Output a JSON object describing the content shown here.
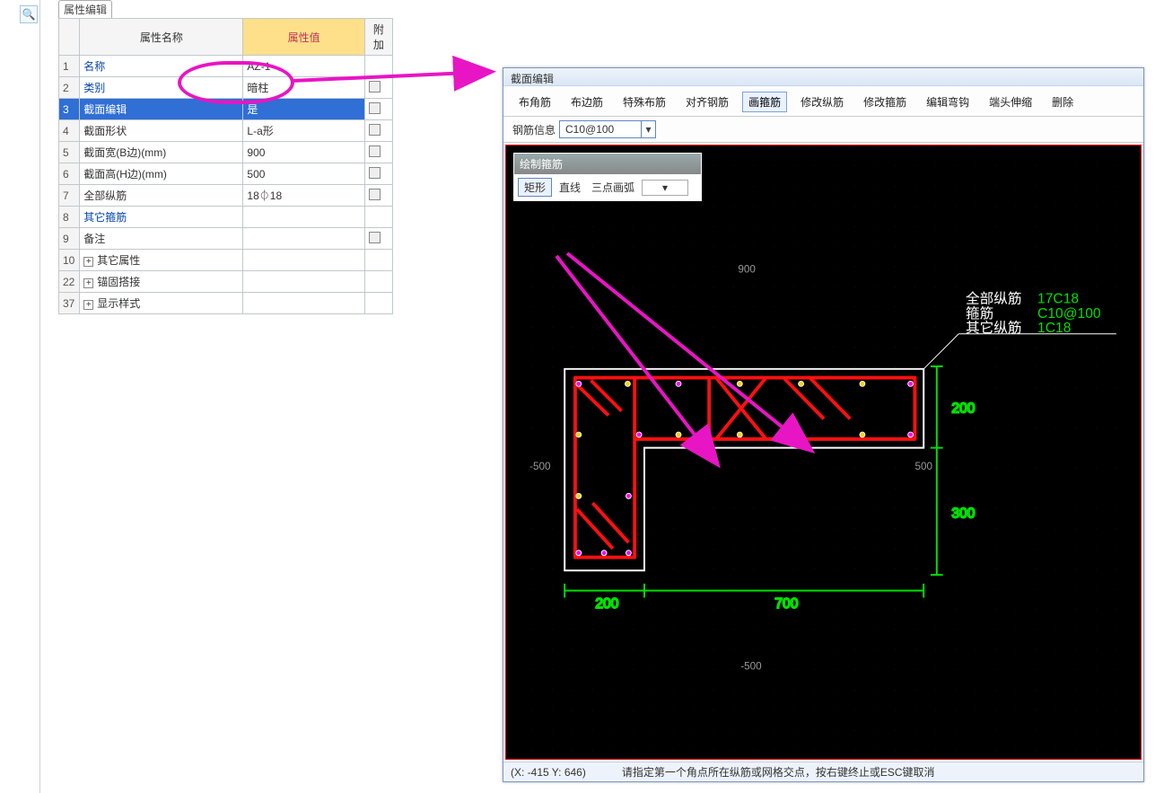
{
  "leftStrip": {
    "searchIcon": "🔍"
  },
  "propertyTab": {
    "label": "属性编辑"
  },
  "propertyGrid": {
    "headers": {
      "num": "",
      "name": "属性名称",
      "value": "属性值",
      "extra": "附加"
    },
    "rows": [
      {
        "num": "1",
        "name": "名称",
        "nameClass": "blue-text",
        "value": "AZ-1",
        "hasCheck": false
      },
      {
        "num": "2",
        "name": "类别",
        "nameClass": "blue-text",
        "value": "暗柱",
        "hasCheck": true
      },
      {
        "num": "3",
        "name": "截面编辑",
        "nameClass": "",
        "value": "是",
        "hasCheck": true,
        "selected": true
      },
      {
        "num": "4",
        "name": "截面形状",
        "nameClass": "",
        "value": "L-a形",
        "hasCheck": true
      },
      {
        "num": "5",
        "name": "截面宽(B边)(mm)",
        "nameClass": "",
        "value": "900",
        "hasCheck": true
      },
      {
        "num": "6",
        "name": "截面高(H边)(mm)",
        "nameClass": "",
        "value": "500",
        "hasCheck": true
      },
      {
        "num": "7",
        "name": "全部纵筋",
        "nameClass": "",
        "value": "18⏀18",
        "hasCheck": true
      },
      {
        "num": "8",
        "name": "其它箍筋",
        "nameClass": "blue-text",
        "value": "",
        "hasCheck": false
      },
      {
        "num": "9",
        "name": "备注",
        "nameClass": "",
        "value": "",
        "hasCheck": true
      },
      {
        "num": "10",
        "name": "其它属性",
        "nameClass": "",
        "value": "",
        "hasCheck": false,
        "expand": true
      },
      {
        "num": "22",
        "name": "锚固搭接",
        "nameClass": "",
        "value": "",
        "hasCheck": false,
        "expand": true
      },
      {
        "num": "37",
        "name": "显示样式",
        "nameClass": "",
        "value": "",
        "hasCheck": false,
        "expand": true
      }
    ]
  },
  "editor": {
    "title": "截面编辑",
    "toolbar": [
      {
        "label": "布角筋",
        "active": false
      },
      {
        "label": "布边筋",
        "active": false
      },
      {
        "label": "特殊布筋",
        "active": false
      },
      {
        "label": "对齐钢筋",
        "active": false
      },
      {
        "label": "画箍筋",
        "active": true
      },
      {
        "label": "修改纵筋",
        "active": false
      },
      {
        "label": "修改箍筋",
        "active": false
      },
      {
        "label": "编辑弯钩",
        "active": false
      },
      {
        "label": "端头伸缩",
        "active": false
      },
      {
        "label": "删除",
        "active": false
      }
    ],
    "reinforceInfoLabel": "钢筋信息",
    "reinforceInfoValue": "C10@100",
    "palette": {
      "title": "绘制箍筋",
      "items": [
        {
          "label": "矩形",
          "active": true
        },
        {
          "label": "直线",
          "active": false
        },
        {
          "label": "三点画弧",
          "active": false
        }
      ],
      "selectArrow": "▾"
    },
    "canvas": {
      "dims": {
        "topW": "900",
        "bottomH": "200",
        "dim200": "200",
        "dim300": "300",
        "dim700": "700",
        "axis500": "500"
      },
      "legend": {
        "all": {
          "label": "全部纵筋",
          "value": "17C18"
        },
        "stir": {
          "label": "箍筋",
          "value": "C10@100"
        },
        "other": {
          "label": "其它纵筋",
          "value": "1C18"
        }
      }
    },
    "status": {
      "coord": "(X: -415 Y: 646)",
      "hint": "请指定第一个角点所在纵筋或网格交点，按右键终止或ESC键取消"
    }
  }
}
